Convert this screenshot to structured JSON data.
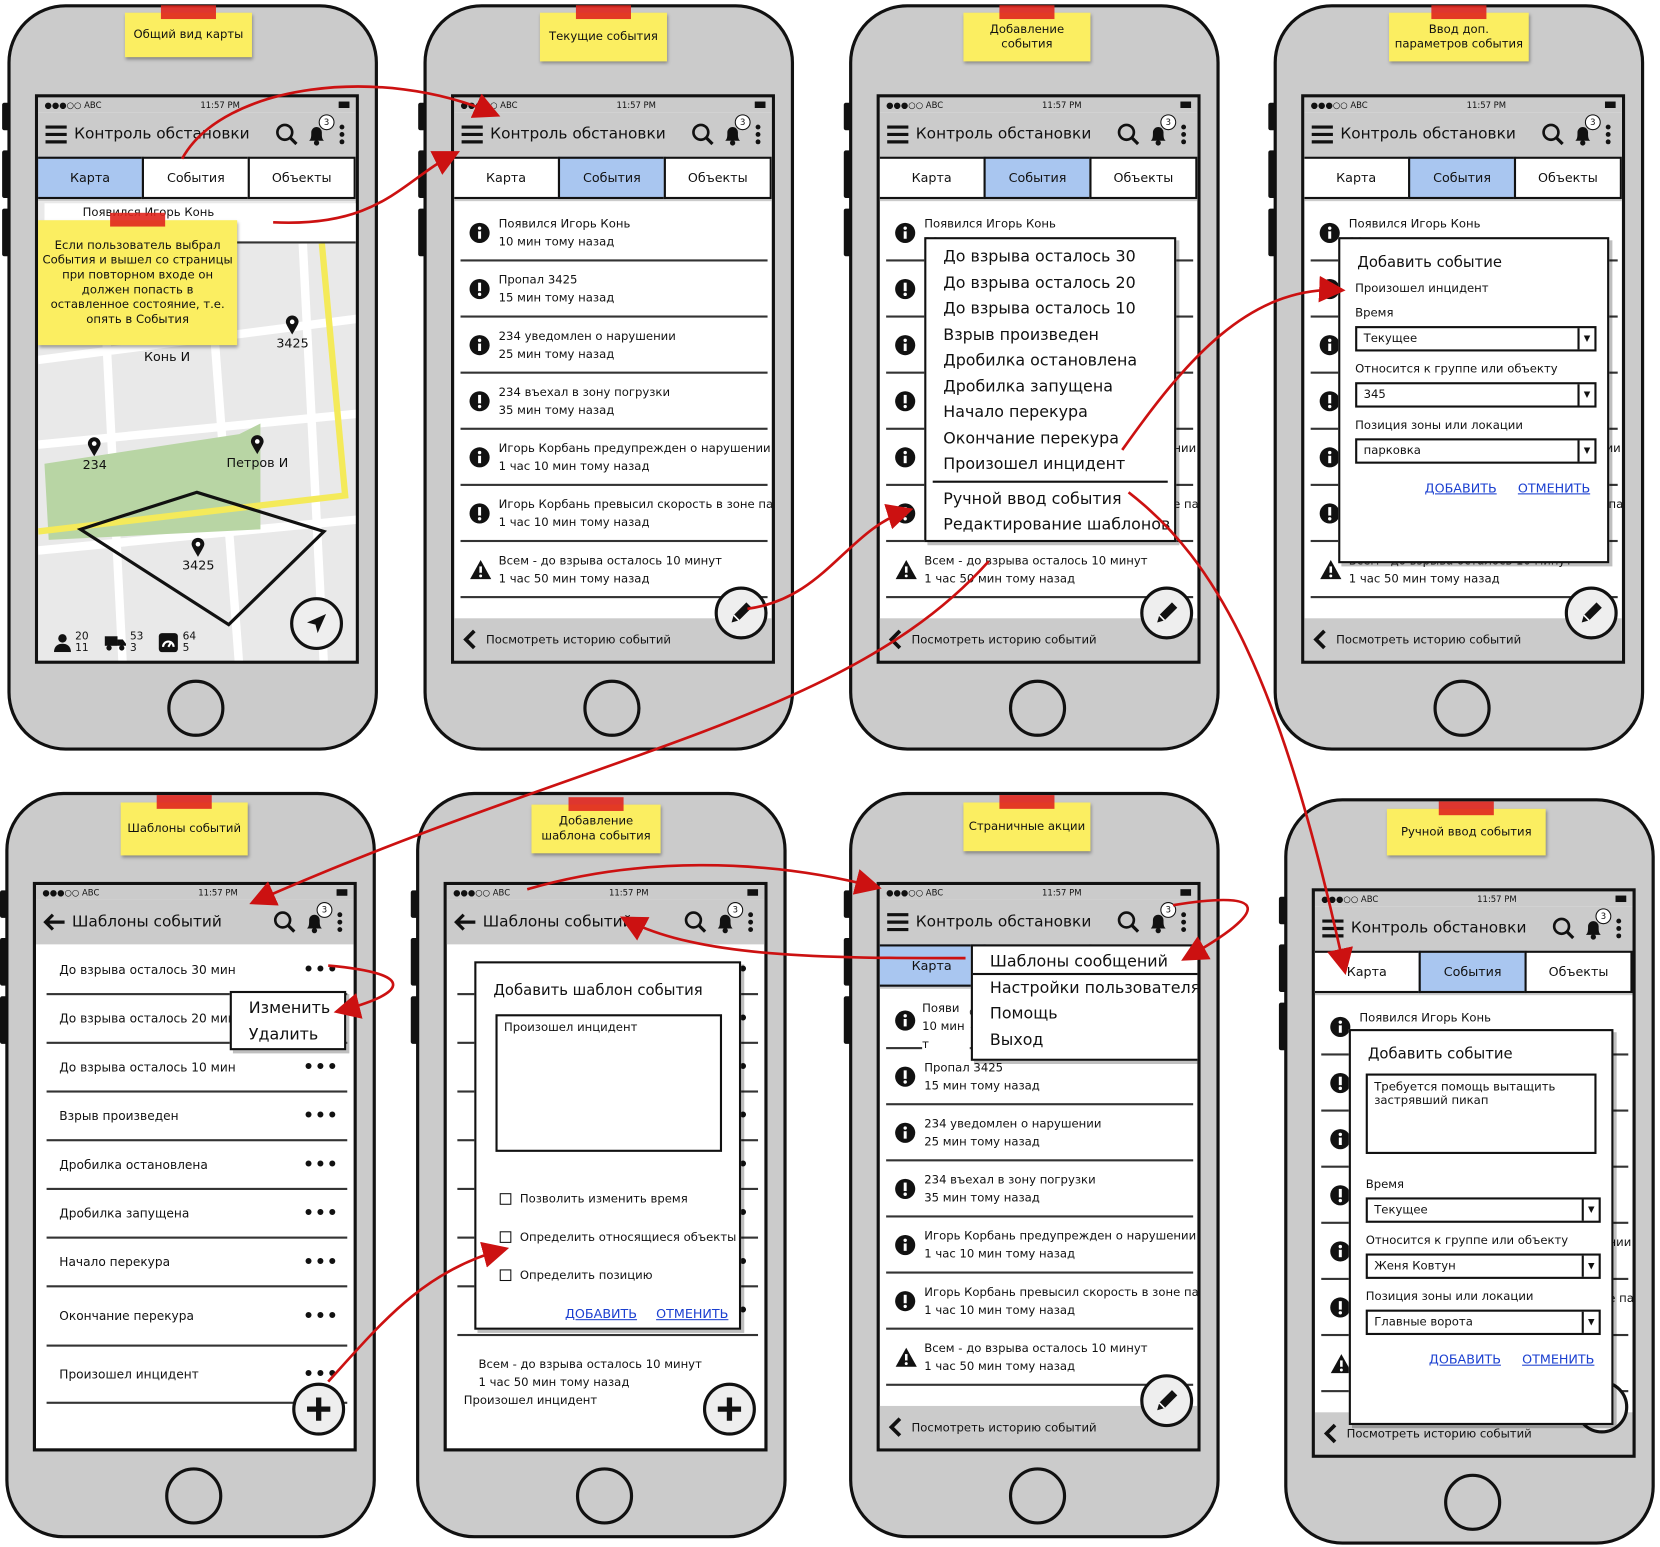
{
  "status": {
    "carrier": "●●●○○ ABC",
    "time": "11:57 PM"
  },
  "app": {
    "title": "Контроль обстановки",
    "templates_title": "Шаблоны событий",
    "badge": "3"
  },
  "tabs": [
    "Карта",
    "События",
    "Объекты"
  ],
  "stickies": {
    "s1": "Общий вид карты",
    "s2": "Текущие события",
    "s3": "Добавление события",
    "s4": "Ввод доп. параметров события",
    "s5": "Шаблоны событий",
    "s6": "Добавление шаблона события",
    "s7": "Страничные акции",
    "s8": "Ручной ввод события",
    "note": "Если пользователь выбрал События и вышел со страницы при повторном входе он должен попасть в оставленное состояние, т.е. опять в События"
  },
  "map": {
    "banner": "Появился Игорь Конь",
    "labels": {
      "kon": "Конь И",
      "m3425": "3425",
      "m234": "234",
      "petrov": "Петров И",
      "zone": "3425"
    },
    "stats": [
      {
        "top": "20",
        "bottom": "11"
      },
      {
        "top": "53",
        "bottom": "3"
      },
      {
        "top": "64",
        "bottom": "5"
      }
    ]
  },
  "events": [
    {
      "icon": "info",
      "line1": "Появился Игорь Конь",
      "line2": "10 мин тому назад"
    },
    {
      "icon": "alert",
      "line1": "Пропал 3425",
      "line2": "15 мин тому назад"
    },
    {
      "icon": "info",
      "line1": "234 уведомлен о нарушении",
      "line2": "25 мин тому назад"
    },
    {
      "icon": "alert",
      "line1": "234 въехал в зону погрузки",
      "line2": "35 мин тому назад"
    },
    {
      "icon": "info",
      "line1": "Игорь Корбань предупрежден о нарушении",
      "line2": "1 час 10 мин тому назад"
    },
    {
      "icon": "alert",
      "line1": "Игорь Корбань превысил скорость в зоне парк",
      "line2": "1 час 10 мин тому назад"
    },
    {
      "icon": "warn",
      "line1": "Всем - до взрыва осталось 10 минут",
      "line2": "1 час 50 мин тому назад"
    }
  ],
  "history": "Посмотреть историю событий",
  "menu_templates": [
    "До взрыва осталось 30",
    "До взрыва осталось 20",
    "До взрыва осталось 10",
    "Взрыв произведен",
    "Дробилка остановлена",
    "Дробилка запущена",
    "Начало перекура",
    "Окончание перекура",
    "Произошел инцидент"
  ],
  "menu_actions": [
    "Ручной ввод события",
    "Редактирование шаблонов"
  ],
  "add_event": {
    "title": "Добавить событие",
    "incident": "Произошел инцидент",
    "time_label": "Время",
    "time_value": "Текущее",
    "group_label": "Относится к группе или объекту",
    "group_value": "345",
    "zone_label": "Позиция зоны или локации",
    "zone_value": "парковка",
    "add": "ДОБАВИТЬ",
    "cancel": "ОТМЕНИТЬ"
  },
  "manual_event": {
    "text": "Требуется помощь вытащить застрявший пикап",
    "group_value": "Женя Ковтун",
    "zone_value": "Главные ворота"
  },
  "templates": [
    "До взрыва осталось 30 мин",
    "До взрыва осталось 20 мин",
    "До взрыва осталось 10 мин",
    "Взрыв произведен",
    "Дробилка остановлена",
    "Дробилка запущена",
    "Начало перекура",
    "Окончание перекура",
    "Произошел инцидент"
  ],
  "template_menu": [
    "Изменить",
    "Удалить"
  ],
  "add_template": {
    "title": "Добавить шаблон события",
    "text": "Произошел инцидент",
    "cb1": "Позволить изменить время",
    "cb2": "Определить относящиеся объекты",
    "cb3": "Определить позицию"
  },
  "page_menu": [
    "Шаблоны сообщений",
    "Настройки пользователя",
    "Помощь",
    "Выход"
  ],
  "partial": {
    "s6_l1": "Всем - до взрыва осталось 10 минут",
    "s6_l2": "1 час 50 мин тому назад",
    "s6_l3": "Произошел инцидент",
    "s7_l1": "Появи",
    "s7_l2": "10 мин т"
  },
  "colors": {
    "accent_tab": "#a9c6f0",
    "sticky": "#fbee61",
    "arrow": "#cc1111",
    "link": "#1a3fd0"
  }
}
